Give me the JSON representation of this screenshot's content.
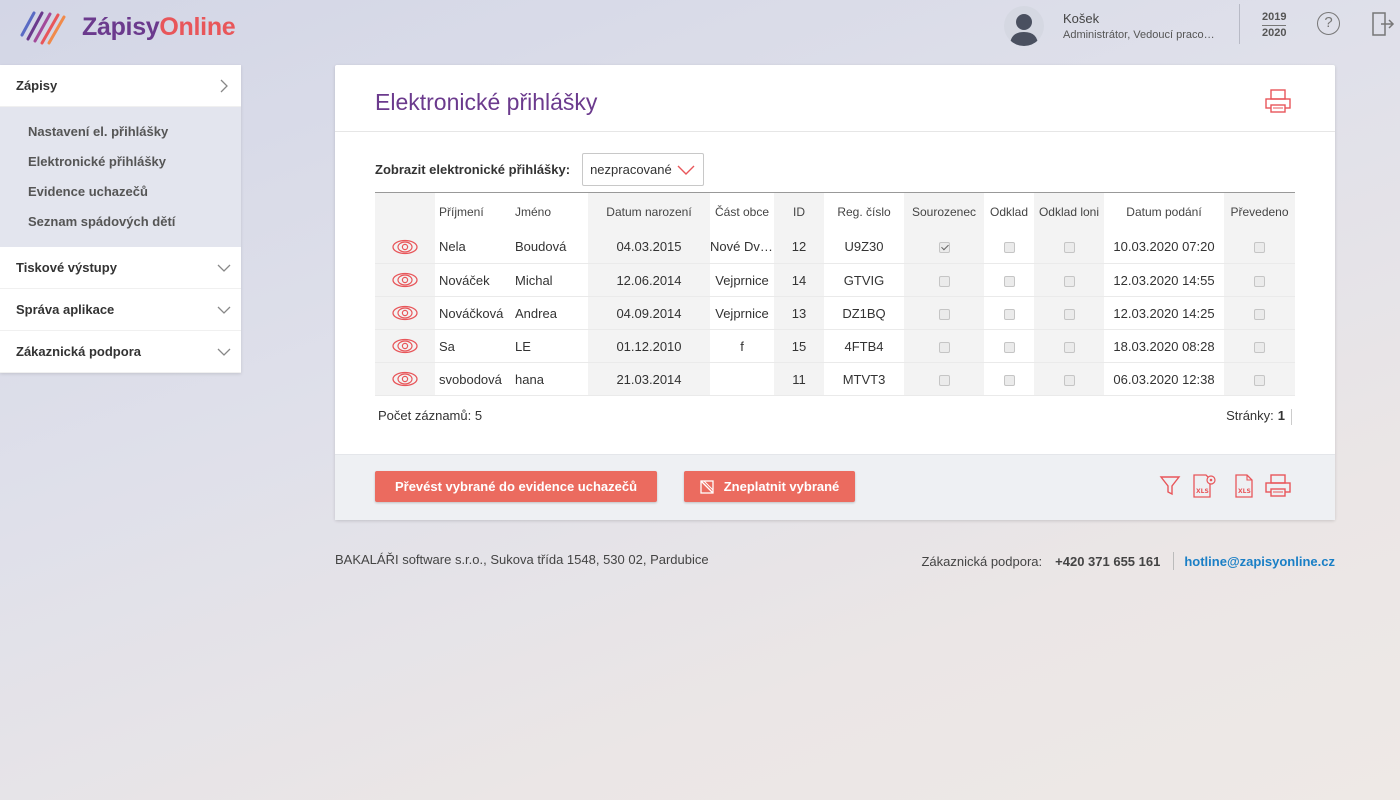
{
  "app": {
    "logo_part1": "Zápisy",
    "logo_part2": "Online"
  },
  "user": {
    "name": "Košek",
    "role": "Administrátor, Vedoucí pracoviště"
  },
  "year": {
    "from": "2019",
    "to": "2020"
  },
  "icons": {
    "help": "?"
  },
  "sidebar": {
    "active_section": "Zápisy",
    "sub_items": [
      "Nastavení el. přihlášky",
      "Elektronické přihlášky",
      "Evidence uchazečů",
      "Seznam spádových dětí"
    ],
    "sections": [
      "Tiskové výstupy",
      "Správa aplikace",
      "Zákaznická podpora"
    ]
  },
  "panel": {
    "title": "Elektronické přihlášky",
    "filter_label": "Zobrazit elektronické přihlášky:",
    "filter_value": "nezpracované",
    "columns": [
      "",
      "Příjmení",
      "Jméno",
      "Datum narození",
      "Část obce",
      "ID",
      "Reg. číslo",
      "Sourozenec",
      "Odklad",
      "Odklad loni",
      "Datum podání",
      "Převedeno"
    ],
    "rows": [
      {
        "prijmeni": "Nela",
        "jmeno": "Boudová",
        "datum": "04.03.2015",
        "cast": "Nové Dvory",
        "id": "12",
        "reg": "U9Z30",
        "sourozenec": true,
        "odklad": false,
        "odklad_loni": false,
        "podani": "10.03.2020 07:20",
        "prevedeno": false
      },
      {
        "prijmeni": "Nováček",
        "jmeno": "Michal",
        "datum": "12.06.2014",
        "cast": "Vejprnice",
        "id": "14",
        "reg": "GTVIG",
        "sourozenec": false,
        "odklad": false,
        "odklad_loni": false,
        "podani": "12.03.2020 14:55",
        "prevedeno": false
      },
      {
        "prijmeni": "Nováčková",
        "jmeno": "Andrea",
        "datum": "04.09.2014",
        "cast": "Vejprnice",
        "id": "13",
        "reg": "DZ1BQ",
        "sourozenec": false,
        "odklad": false,
        "odklad_loni": false,
        "podani": "12.03.2020 14:25",
        "prevedeno": false
      },
      {
        "prijmeni": "Sa",
        "jmeno": "LE",
        "datum": "01.12.2010",
        "cast": "f",
        "id": "15",
        "reg": "4FTB4",
        "sourozenec": false,
        "odklad": false,
        "odklad_loni": false,
        "podani": "18.03.2020 08:28",
        "prevedeno": false
      },
      {
        "prijmeni": "svobodová",
        "jmeno": "hana",
        "datum": "21.03.2014",
        "cast": "",
        "id": "11",
        "reg": "MTVT3",
        "sourozenec": false,
        "odklad": false,
        "odklad_loni": false,
        "podani": "06.03.2020 12:38",
        "prevedeno": false
      }
    ],
    "count_label": "Počet záznamů: 5",
    "pages_label": "Stránky:",
    "current_page": "1",
    "btn_convert": "Převést vybrané do evidence uchazečů",
    "btn_invalidate": "Zneplatnit vybrané"
  },
  "footer": {
    "address": "BAKALÁŘI software s.r.o., Sukova třída 1548, 530 02, Pardubice",
    "support_label": "Zákaznická podpora:",
    "phone": "+420 371 655 161",
    "email": "hotline@zapisyonline.cz"
  },
  "colors": {
    "accent": "#eb6b5f",
    "brand_purple": "#6b3a8d",
    "link": "#1a7fc6"
  }
}
